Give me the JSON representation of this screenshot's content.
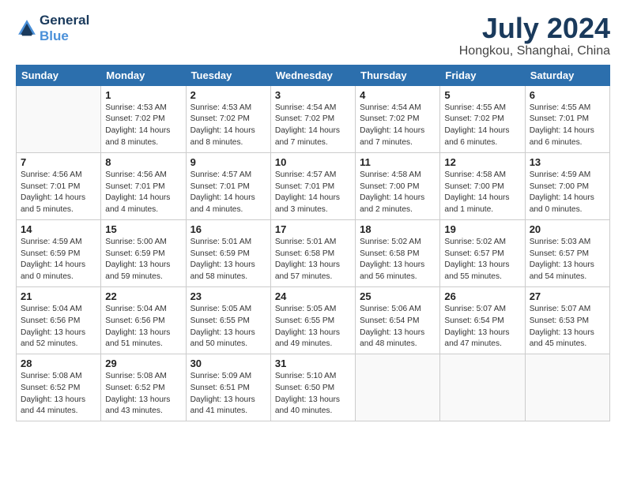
{
  "header": {
    "logo_line1": "General",
    "logo_line2": "Blue",
    "month_year": "July 2024",
    "location": "Hongkou, Shanghai, China"
  },
  "days_of_week": [
    "Sunday",
    "Monday",
    "Tuesday",
    "Wednesday",
    "Thursday",
    "Friday",
    "Saturday"
  ],
  "weeks": [
    [
      {
        "day": "",
        "info": ""
      },
      {
        "day": "1",
        "info": "Sunrise: 4:53 AM\nSunset: 7:02 PM\nDaylight: 14 hours\nand 8 minutes."
      },
      {
        "day": "2",
        "info": "Sunrise: 4:53 AM\nSunset: 7:02 PM\nDaylight: 14 hours\nand 8 minutes."
      },
      {
        "day": "3",
        "info": "Sunrise: 4:54 AM\nSunset: 7:02 PM\nDaylight: 14 hours\nand 7 minutes."
      },
      {
        "day": "4",
        "info": "Sunrise: 4:54 AM\nSunset: 7:02 PM\nDaylight: 14 hours\nand 7 minutes."
      },
      {
        "day": "5",
        "info": "Sunrise: 4:55 AM\nSunset: 7:02 PM\nDaylight: 14 hours\nand 6 minutes."
      },
      {
        "day": "6",
        "info": "Sunrise: 4:55 AM\nSunset: 7:01 PM\nDaylight: 14 hours\nand 6 minutes."
      }
    ],
    [
      {
        "day": "7",
        "info": "Sunrise: 4:56 AM\nSunset: 7:01 PM\nDaylight: 14 hours\nand 5 minutes."
      },
      {
        "day": "8",
        "info": "Sunrise: 4:56 AM\nSunset: 7:01 PM\nDaylight: 14 hours\nand 4 minutes."
      },
      {
        "day": "9",
        "info": "Sunrise: 4:57 AM\nSunset: 7:01 PM\nDaylight: 14 hours\nand 4 minutes."
      },
      {
        "day": "10",
        "info": "Sunrise: 4:57 AM\nSunset: 7:01 PM\nDaylight: 14 hours\nand 3 minutes."
      },
      {
        "day": "11",
        "info": "Sunrise: 4:58 AM\nSunset: 7:00 PM\nDaylight: 14 hours\nand 2 minutes."
      },
      {
        "day": "12",
        "info": "Sunrise: 4:58 AM\nSunset: 7:00 PM\nDaylight: 14 hours\nand 1 minute."
      },
      {
        "day": "13",
        "info": "Sunrise: 4:59 AM\nSunset: 7:00 PM\nDaylight: 14 hours\nand 0 minutes."
      }
    ],
    [
      {
        "day": "14",
        "info": "Sunrise: 4:59 AM\nSunset: 6:59 PM\nDaylight: 14 hours\nand 0 minutes."
      },
      {
        "day": "15",
        "info": "Sunrise: 5:00 AM\nSunset: 6:59 PM\nDaylight: 13 hours\nand 59 minutes."
      },
      {
        "day": "16",
        "info": "Sunrise: 5:01 AM\nSunset: 6:59 PM\nDaylight: 13 hours\nand 58 minutes."
      },
      {
        "day": "17",
        "info": "Sunrise: 5:01 AM\nSunset: 6:58 PM\nDaylight: 13 hours\nand 57 minutes."
      },
      {
        "day": "18",
        "info": "Sunrise: 5:02 AM\nSunset: 6:58 PM\nDaylight: 13 hours\nand 56 minutes."
      },
      {
        "day": "19",
        "info": "Sunrise: 5:02 AM\nSunset: 6:57 PM\nDaylight: 13 hours\nand 55 minutes."
      },
      {
        "day": "20",
        "info": "Sunrise: 5:03 AM\nSunset: 6:57 PM\nDaylight: 13 hours\nand 54 minutes."
      }
    ],
    [
      {
        "day": "21",
        "info": "Sunrise: 5:04 AM\nSunset: 6:56 PM\nDaylight: 13 hours\nand 52 minutes."
      },
      {
        "day": "22",
        "info": "Sunrise: 5:04 AM\nSunset: 6:56 PM\nDaylight: 13 hours\nand 51 minutes."
      },
      {
        "day": "23",
        "info": "Sunrise: 5:05 AM\nSunset: 6:55 PM\nDaylight: 13 hours\nand 50 minutes."
      },
      {
        "day": "24",
        "info": "Sunrise: 5:05 AM\nSunset: 6:55 PM\nDaylight: 13 hours\nand 49 minutes."
      },
      {
        "day": "25",
        "info": "Sunrise: 5:06 AM\nSunset: 6:54 PM\nDaylight: 13 hours\nand 48 minutes."
      },
      {
        "day": "26",
        "info": "Sunrise: 5:07 AM\nSunset: 6:54 PM\nDaylight: 13 hours\nand 47 minutes."
      },
      {
        "day": "27",
        "info": "Sunrise: 5:07 AM\nSunset: 6:53 PM\nDaylight: 13 hours\nand 45 minutes."
      }
    ],
    [
      {
        "day": "28",
        "info": "Sunrise: 5:08 AM\nSunset: 6:52 PM\nDaylight: 13 hours\nand 44 minutes."
      },
      {
        "day": "29",
        "info": "Sunrise: 5:08 AM\nSunset: 6:52 PM\nDaylight: 13 hours\nand 43 minutes."
      },
      {
        "day": "30",
        "info": "Sunrise: 5:09 AM\nSunset: 6:51 PM\nDaylight: 13 hours\nand 41 minutes."
      },
      {
        "day": "31",
        "info": "Sunrise: 5:10 AM\nSunset: 6:50 PM\nDaylight: 13 hours\nand 40 minutes."
      },
      {
        "day": "",
        "info": ""
      },
      {
        "day": "",
        "info": ""
      },
      {
        "day": "",
        "info": ""
      }
    ]
  ]
}
